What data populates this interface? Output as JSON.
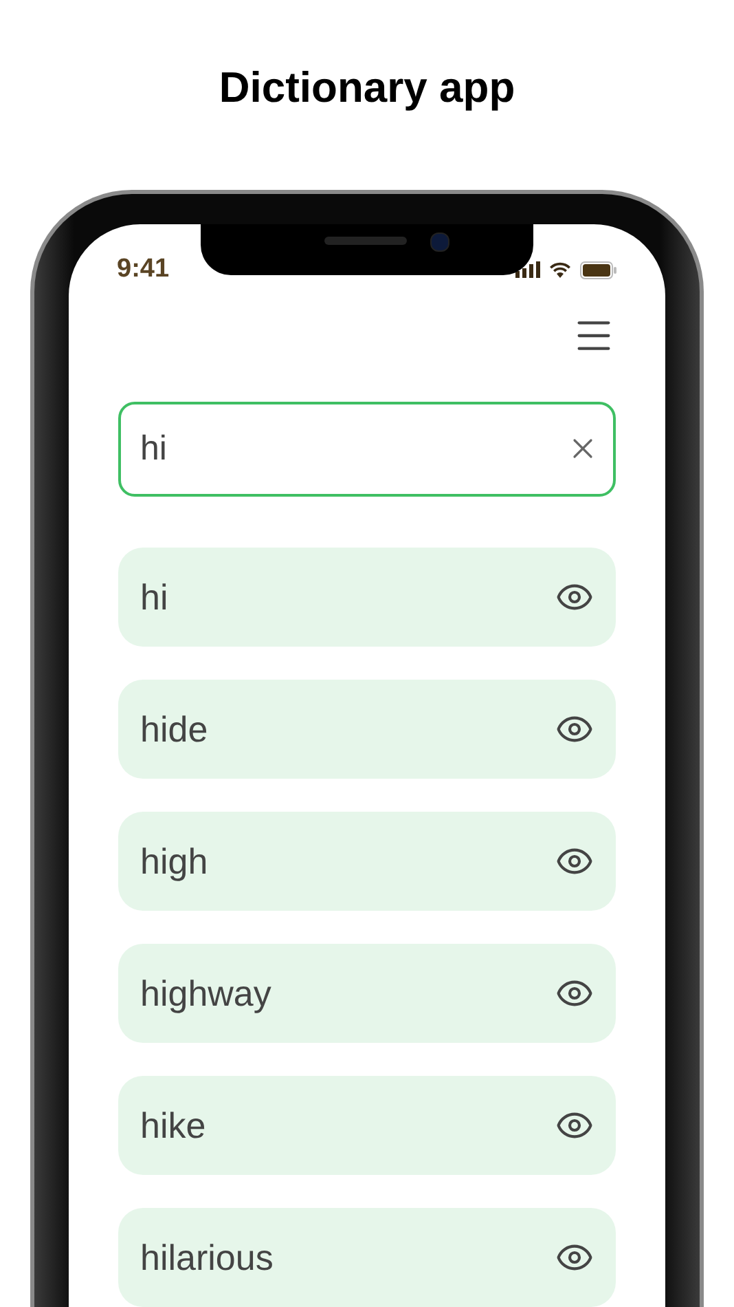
{
  "heading": "Dictionary app",
  "status_bar": {
    "time": "9:41"
  },
  "search": {
    "value": "hi"
  },
  "results": [
    {
      "word": "hi"
    },
    {
      "word": "hide"
    },
    {
      "word": "high"
    },
    {
      "word": "highway"
    },
    {
      "word": "hike"
    },
    {
      "word": "hilarious"
    }
  ]
}
